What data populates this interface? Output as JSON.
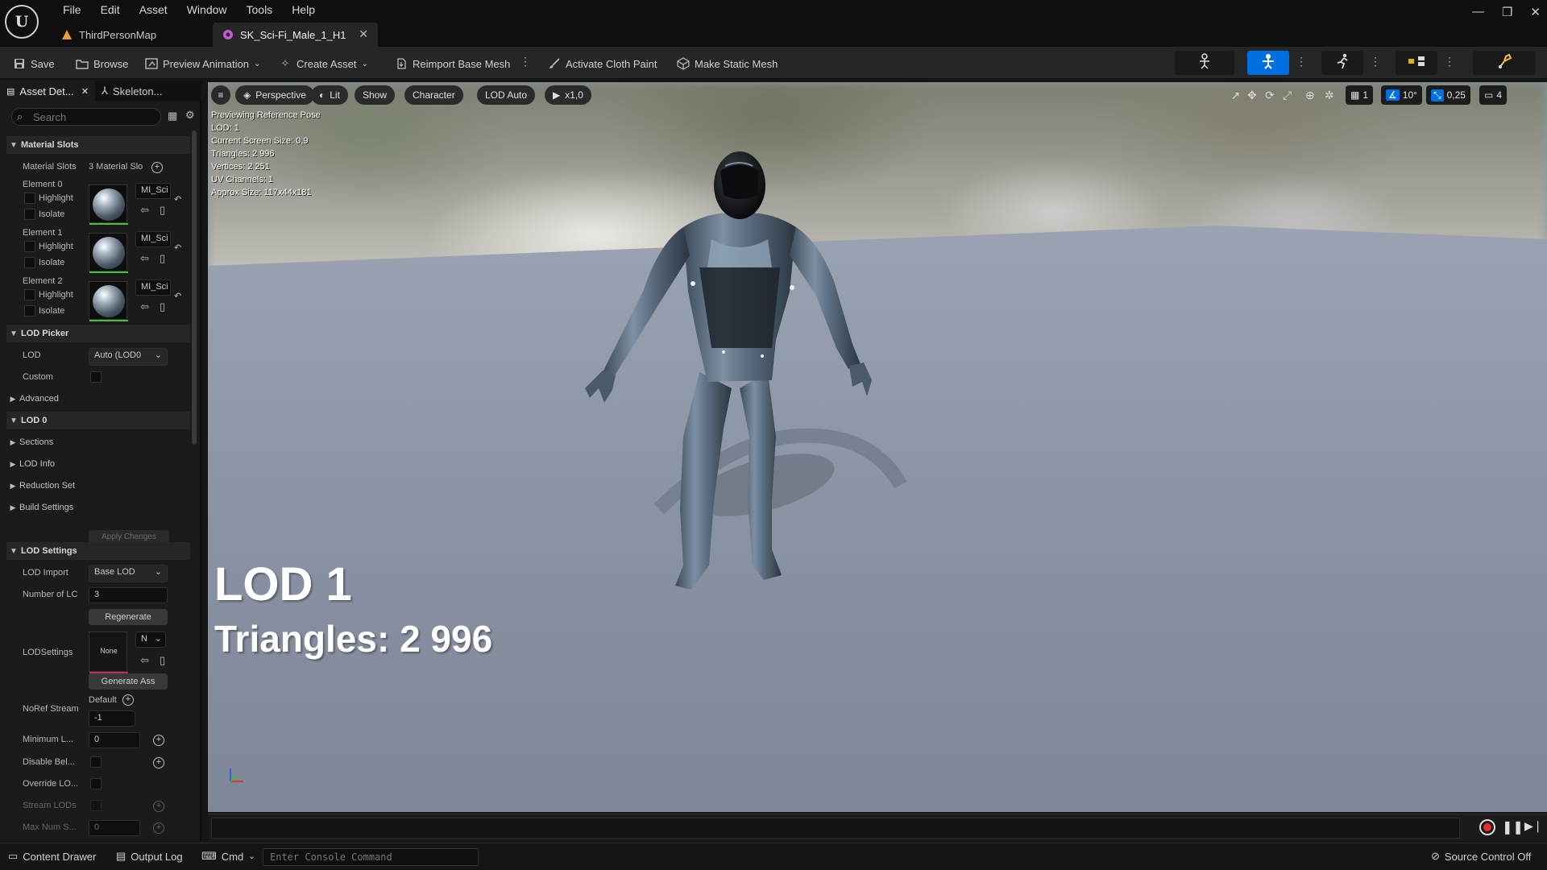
{
  "app": {
    "menu": [
      "File",
      "Edit",
      "Asset",
      "Window",
      "Tools",
      "Help"
    ],
    "tabs": [
      {
        "label": "ThirdPersonMap",
        "active": false
      },
      {
        "label": "SK_Sci-Fi_Male_1_H1",
        "active": true
      }
    ],
    "window_controls": [
      "minimize-icon",
      "restore-icon",
      "close-icon"
    ]
  },
  "toolbar": {
    "save": "Save",
    "browse": "Browse",
    "preview_animation": "Preview Animation",
    "create_asset": "Create Asset",
    "reimport": "Reimport Base Mesh",
    "cloth_paint": "Activate Cloth Paint",
    "static_mesh": "Make Static Mesh",
    "modes": [
      "skeleton-mode",
      "mesh-mode",
      "animation-mode",
      "physics-mode",
      "blueprint-mode"
    ],
    "active_mode": "mesh-mode"
  },
  "panel": {
    "tabs": [
      "Asset Det...",
      "Skeleton..."
    ],
    "search_placeholder": "Search",
    "material_slots": {
      "header": "Material Slots",
      "label": "Material Slots",
      "count": "3 Material Slo",
      "elements": [
        {
          "label": "Element 0",
          "highlight": "Highlight",
          "isolate": "Isolate",
          "material": "MI_Sci"
        },
        {
          "label": "Element 1",
          "highlight": "Highlight",
          "isolate": "Isolate",
          "material": "MI_Sci"
        },
        {
          "label": "Element 2",
          "highlight": "Highlight",
          "isolate": "Isolate",
          "material": "MI_Sci"
        }
      ]
    },
    "lod_picker": {
      "header": "LOD Picker",
      "lod_label": "LOD",
      "lod_value": "Auto (LOD0",
      "custom_label": "Custom",
      "advanced": "Advanced"
    },
    "lod0": {
      "header": "LOD 0",
      "items": [
        "Sections",
        "LOD Info",
        "Reduction Set",
        "Build Settings"
      ],
      "apply": "Apply Changes"
    },
    "lod_settings": {
      "header": "LOD Settings",
      "lod_import_label": "LOD Import",
      "lod_import_value": "Base LOD",
      "num_lods_label": "Number of LC",
      "num_lods_value": "3",
      "regenerate": "Regenerate",
      "lodsettings_label": "LODSettings",
      "lodsettings_thumb": "None",
      "lodsettings_combo": "N",
      "generate": "Generate Ass",
      "noref_label": "NoRef Stream",
      "noref_default": "Default",
      "noref_value": "-1",
      "min_lod_label": "Minimum L...",
      "min_lod_value": "0",
      "disable_below_label": "Disable Bel...",
      "override_label": "Override LO...",
      "stream_lods_label": "Stream LODs",
      "max_num_label": "Max Num S...",
      "max_num_value": "0"
    }
  },
  "viewport": {
    "buttons": {
      "perspective": "Perspective",
      "lit": "Lit",
      "show": "Show",
      "character": "Character",
      "lod": "LOD Auto",
      "speed": "x1,0"
    },
    "right": {
      "grid": "1",
      "angle": "10°",
      "scale": "0,25",
      "camera": "4"
    },
    "stats": [
      "Previewing Reference Pose",
      "LOD: 1",
      "Current Screen Size: 0,9",
      "Triangles: 2 996",
      "Vertices: 2 251",
      "UV Channels: 1",
      "Approx Size: 117x44x181"
    ],
    "big_lod": "LOD 1",
    "big_triangles": "Triangles: 2 996"
  },
  "statusbar": {
    "content_drawer": "Content Drawer",
    "output_log": "Output Log",
    "cmd": "Cmd",
    "console_placeholder": "Enter Console Command",
    "source_control": "Source Control Off"
  }
}
